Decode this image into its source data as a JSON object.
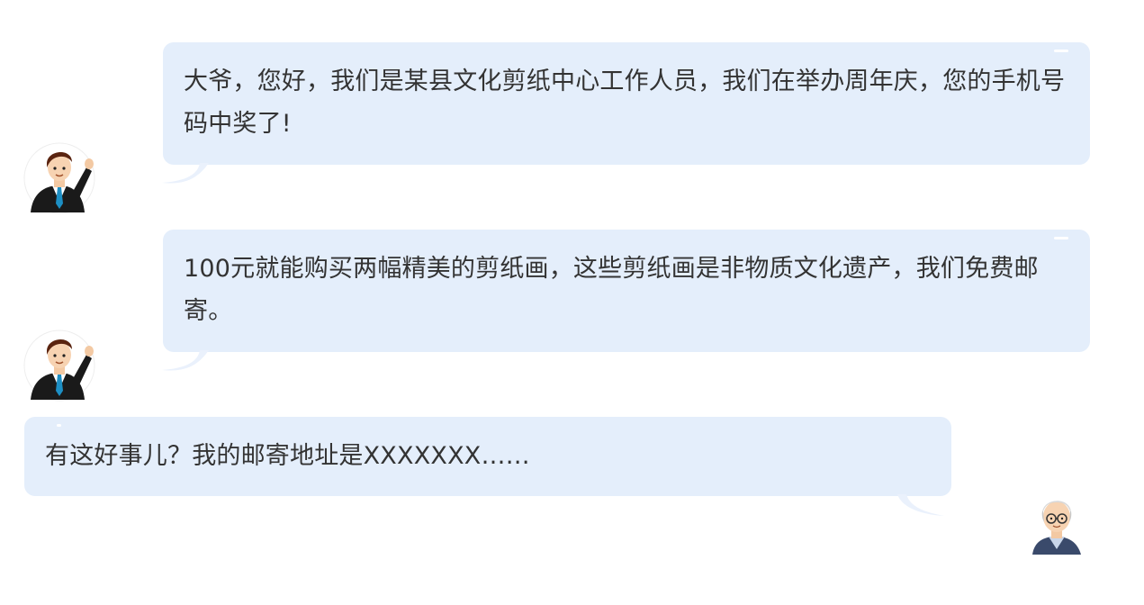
{
  "messages": [
    {
      "sender": "agent",
      "avatar_icon": "businessman-avatar-icon",
      "text": "大爷，您好，我们是某县文化剪纸中心工作人员，我们在举办周年庆，您的手机号码中奖了!"
    },
    {
      "sender": "agent",
      "avatar_icon": "businessman-avatar-icon",
      "text": "100元就能购买两幅精美的剪纸画，这些剪纸画是非物质文化遗产，我们免费邮寄。"
    },
    {
      "sender": "elder",
      "avatar_icon": "elderly-man-avatar-icon",
      "text": "有这好事儿？我的邮寄地址是XXXXXXX……"
    }
  ],
  "colors": {
    "bubble": "#e4eefb",
    "text": "#333333",
    "background": "#ffffff",
    "tail": "#eef3fc"
  }
}
